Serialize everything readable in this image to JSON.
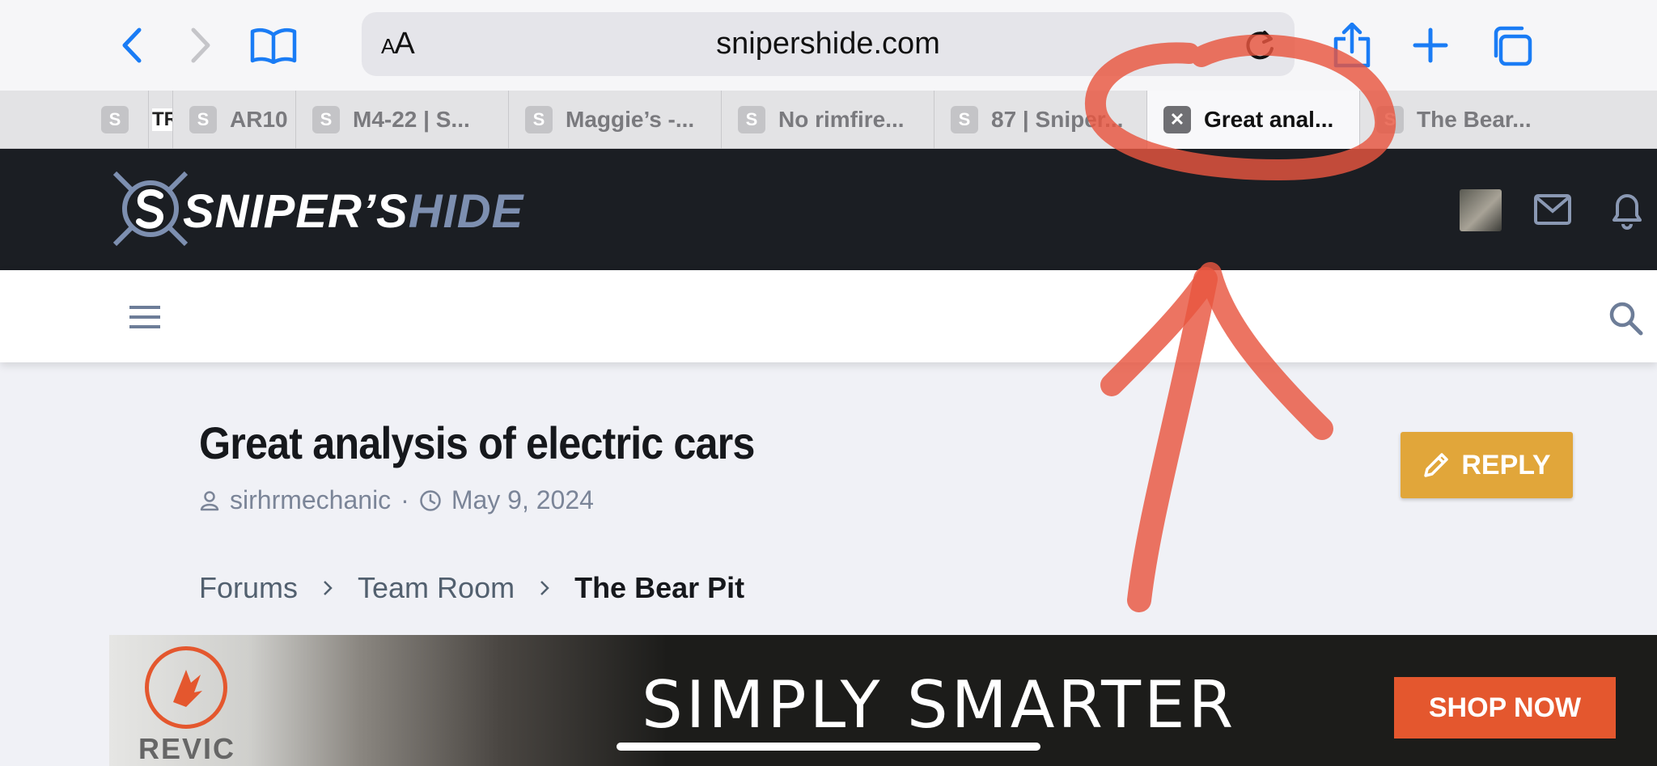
{
  "browser": {
    "url": "snipershide.com",
    "text_size_label_small": "A",
    "text_size_label_large": "A",
    "icons": [
      "back-icon",
      "forward-icon",
      "bookmarks-icon",
      "reload-icon",
      "share-icon",
      "new-tab-icon",
      "tabs-overview-icon"
    ]
  },
  "tabs": [
    {
      "favicon": "S",
      "label": ""
    },
    {
      "favicon": "TR",
      "label": ""
    },
    {
      "favicon": "S",
      "label": "AR10"
    },
    {
      "favicon": "S",
      "label": "M4-22 | S..."
    },
    {
      "favicon": "S",
      "label": "Maggie’s -..."
    },
    {
      "favicon": "S",
      "label": "No rimfire..."
    },
    {
      "favicon": "S",
      "label": "87 | Sniper..."
    },
    {
      "favicon": "✕",
      "label": "Great anal...",
      "active": true
    },
    {
      "favicon": "S",
      "label": "The Bear..."
    }
  ],
  "site": {
    "logo_part1": "SNIPER’S",
    "logo_part2": "HIDE",
    "brand_colors": {
      "header_bg": "#1b1e23",
      "logo_accent": "#7d8fb0",
      "reply_button": "#e1a63a"
    }
  },
  "thread": {
    "title": "Great analysis of electric cars",
    "author": "sirhrmechanic",
    "separator": "·",
    "date": "May 9, 2024",
    "reply_label": "REPLY"
  },
  "breadcrumb": [
    "Forums",
    "Team Room",
    "The Bear Pit"
  ],
  "ad": {
    "brand": "REVIC",
    "headline": "SIMPLY SMARTER",
    "cta": "SHOP NOW",
    "cta_color": "#e4572e"
  },
  "annotation_color": "#e8553f"
}
